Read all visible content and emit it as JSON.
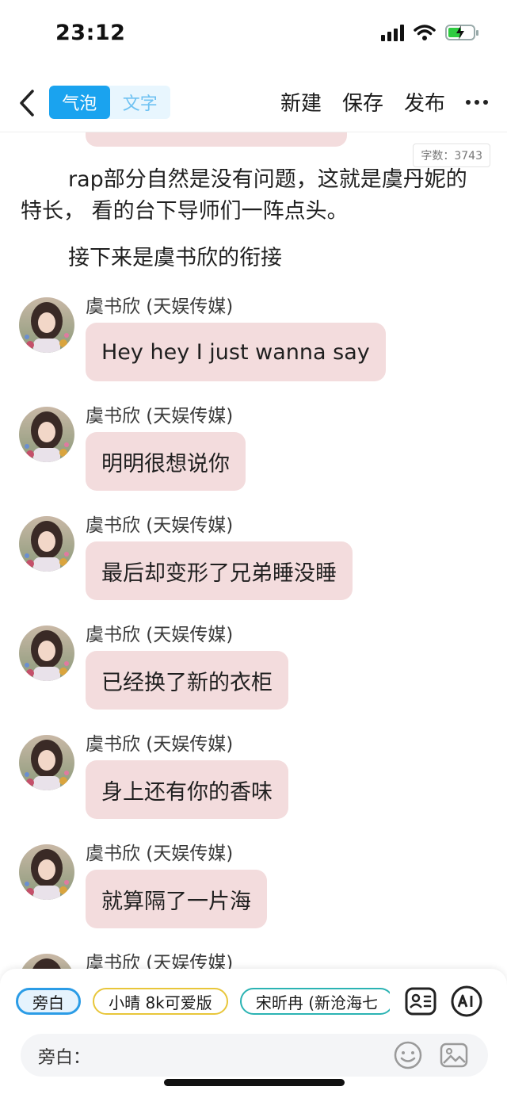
{
  "status_bar": {
    "time": "23:12"
  },
  "nav": {
    "mode_tabs": [
      "气泡",
      "文字"
    ],
    "actions": [
      "新建",
      "保存",
      "发布"
    ]
  },
  "editor": {
    "word_count": "字数：3743",
    "paragraphs": [
      "rap部分自然是没有问题，这就是虞丹妮的特长， 看的台下导师们一阵点头。",
      "接下来是虞书欣的衔接"
    ],
    "messages": [
      {
        "sender": "虞书欣 (天娱传媒)",
        "text": "Hey hey I just wanna say"
      },
      {
        "sender": "虞书欣 (天娱传媒)",
        "text": "明明很想说你"
      },
      {
        "sender": "虞书欣 (天娱传媒)",
        "text": "最后却变形了兄弟睡没睡"
      },
      {
        "sender": "虞书欣 (天娱传媒)",
        "text": "已经换了新的衣柜"
      },
      {
        "sender": "虞书欣 (天娱传媒)",
        "text": "身上还有你的香味"
      },
      {
        "sender": "虞书欣 (天娱传媒)",
        "text": "就算隔了一片海"
      },
      {
        "sender": "虞书欣 (天娱传媒)",
        "text": ""
      }
    ],
    "bubble_color": "#f3dcdd"
  },
  "bottom": {
    "roles": [
      "旁白",
      "小晴 8k可爱版",
      "宋昕冉 (新沧海七"
    ],
    "input_prefix": "旁白："
  },
  "colors": {
    "accent": "#1aa3ef",
    "accent_light": "#e8f6fe"
  }
}
